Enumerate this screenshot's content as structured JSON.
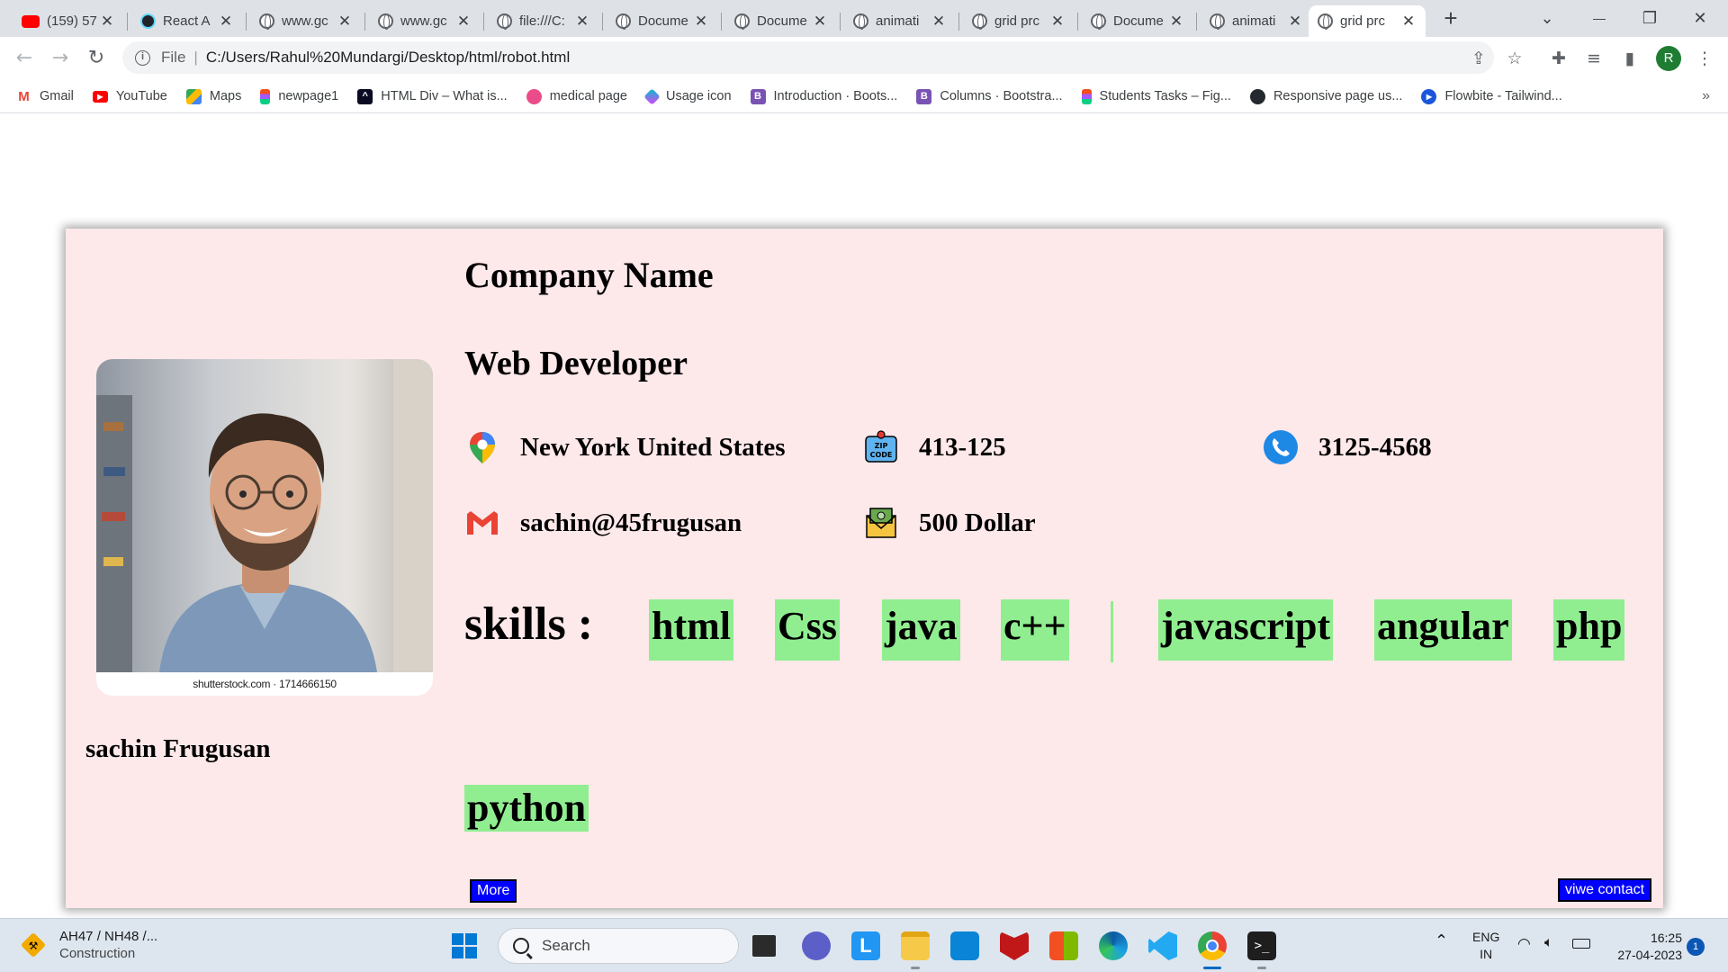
{
  "browser": {
    "tabs": [
      {
        "title": "(159) 57",
        "icon": "youtube-icon"
      },
      {
        "title": "React A",
        "icon": "react-icon"
      },
      {
        "title": "www.gc",
        "icon": "globe-icon"
      },
      {
        "title": "www.gc",
        "icon": "globe-icon"
      },
      {
        "title": "file:///C:",
        "icon": "globe-icon"
      },
      {
        "title": "Docume",
        "icon": "globe-icon"
      },
      {
        "title": "Docume",
        "icon": "globe-icon"
      },
      {
        "title": "animati",
        "icon": "globe-icon"
      },
      {
        "title": "grid prc",
        "icon": "globe-icon"
      },
      {
        "title": "Docume",
        "icon": "globe-icon"
      },
      {
        "title": "animati",
        "icon": "globe-icon"
      },
      {
        "title": "grid prc",
        "icon": "globe-icon",
        "active": true
      }
    ],
    "close_glyph": "✕",
    "new_tab_glyph": "+",
    "window_controls": {
      "dropdown": "⌄",
      "minimize": "—",
      "restore": "❐",
      "close": "✕"
    },
    "address": {
      "scheme": "File",
      "separator": "|",
      "url": "C:/Users/Rahul%20Mundargi/Desktop/html/robot.html"
    },
    "profile_initial": "R",
    "bookmarks": [
      {
        "label": "Gmail",
        "icon": "gmail-icon",
        "color": "#ea4335"
      },
      {
        "label": "YouTube",
        "icon": "youtube-icon",
        "color": "#ff0000"
      },
      {
        "label": "Maps",
        "icon": "maps-icon",
        "color": "#34a853"
      },
      {
        "label": "newpage1",
        "icon": "figma-icon",
        "color": "#f24e1e"
      },
      {
        "label": "HTML Div – What is...",
        "icon": "freecodecamp-icon",
        "color": "#0a0a23"
      },
      {
        "label": "medical page",
        "icon": "dribbble-icon",
        "color": "#ea4c89"
      },
      {
        "label": "Usage icon",
        "icon": "usage-icon",
        "color": "#00c2cb"
      },
      {
        "label": "Introduction · Boots...",
        "icon": "bootstrap-icon",
        "color": "#7952b3"
      },
      {
        "label": "Columns · Bootstra...",
        "icon": "bootstrap-icon",
        "color": "#7952b3"
      },
      {
        "label": "Students Tasks – Fig...",
        "icon": "figma-icon",
        "color": "#f24e1e"
      },
      {
        "label": "Responsive page us...",
        "icon": "github-icon",
        "color": "#24292f"
      },
      {
        "label": "Flowbite - Tailwind...",
        "icon": "flowbite-icon",
        "color": "#1a56db"
      }
    ],
    "bookmarks_overflow": "»"
  },
  "profile": {
    "company": "Company Name",
    "role": "Web Developer",
    "name": "sachin Frugusan",
    "photo_caption": "shutterstock.com · 1714666150",
    "location": "New York United States",
    "zip": "413-125",
    "phone": "3125-4568",
    "email": "sachin@45frugusan",
    "salary": "500 Dollar",
    "skills_label": "skills :",
    "skills": [
      "html",
      "Css",
      "java",
      "c++",
      "javascript",
      "angular",
      "php"
    ],
    "skill_last": "python",
    "more_button": "More",
    "contact_button": "viwe contact",
    "skill_bg": "#90ee90",
    "card_bg": "#fde8ea",
    "button_bg": "#0000ff"
  },
  "taskbar": {
    "weather_title": "AH47 / NH48 /...",
    "weather_sub": "Construction",
    "search_placeholder": "Search",
    "lang_top": "ENG",
    "lang_bottom": "IN",
    "time": "16:25",
    "date": "27-04-2023",
    "notifications": "1"
  }
}
